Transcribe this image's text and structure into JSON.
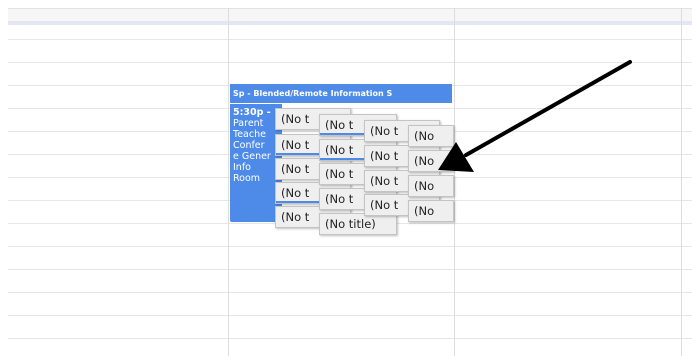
{
  "calendar": {
    "event": {
      "header_text": "Sp - Blended/Remote Information S",
      "time": "5:30p -",
      "lines": [
        "Parent",
        "Teache",
        "Confer",
        "e Gener",
        "Info",
        "Room"
      ]
    },
    "chips": [
      {
        "label": "(No t"
      },
      {
        "label": "(No t"
      },
      {
        "label": "(No t"
      },
      {
        "label": "(No t"
      },
      {
        "label": "(No t"
      },
      {
        "label": "(No t"
      },
      {
        "label": "(No t"
      },
      {
        "label": "(No t"
      },
      {
        "label": "(No t"
      },
      {
        "label": "(No title)"
      },
      {
        "label": "(No t"
      },
      {
        "label": "(No t"
      },
      {
        "label": "(No t"
      },
      {
        "label": "(No t"
      },
      {
        "label": "(No"
      },
      {
        "label": "(No"
      },
      {
        "label": "(No"
      },
      {
        "label": "(No"
      }
    ]
  },
  "colors": {
    "event_blue": "#4e8be8",
    "chip_background": "#efefef",
    "arrow": "#000000"
  },
  "annotation": {
    "icon": "arrow-icon"
  }
}
